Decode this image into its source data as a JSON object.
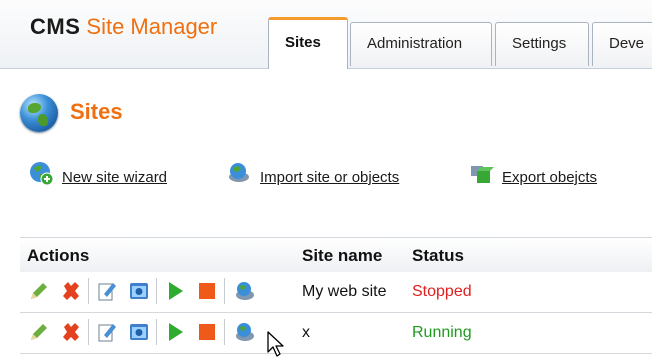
{
  "header": {
    "brand_cms": "CMS",
    "brand_site": "Site Manager",
    "tabs": [
      {
        "label": "Sites",
        "active": true
      },
      {
        "label": "Administration",
        "active": false
      },
      {
        "label": "Settings",
        "active": false
      },
      {
        "label": "Deve",
        "active": false
      }
    ]
  },
  "page": {
    "title": "Sites",
    "title_icon": "globe-icon"
  },
  "actions": [
    {
      "label": "New site wizard",
      "icon": "globe-add-icon"
    },
    {
      "label": "Import site or objects",
      "icon": "import-icon"
    },
    {
      "label": "Export obejcts",
      "icon": "export-icon"
    }
  ],
  "grid": {
    "columns": [
      "Actions",
      "Site name",
      "Status"
    ],
    "row_action_icons": [
      "edit-icon",
      "delete-icon",
      "properties-icon",
      "preview-icon",
      "start-icon",
      "stop-icon",
      "export-row-icon"
    ],
    "rows": [
      {
        "site_name": "My web site",
        "status": "Stopped"
      },
      {
        "site_name": "x",
        "status": "Running"
      }
    ]
  },
  "colors": {
    "accent": "#f06f0f",
    "stopped": "#e02020",
    "running": "#1f9a1f"
  }
}
